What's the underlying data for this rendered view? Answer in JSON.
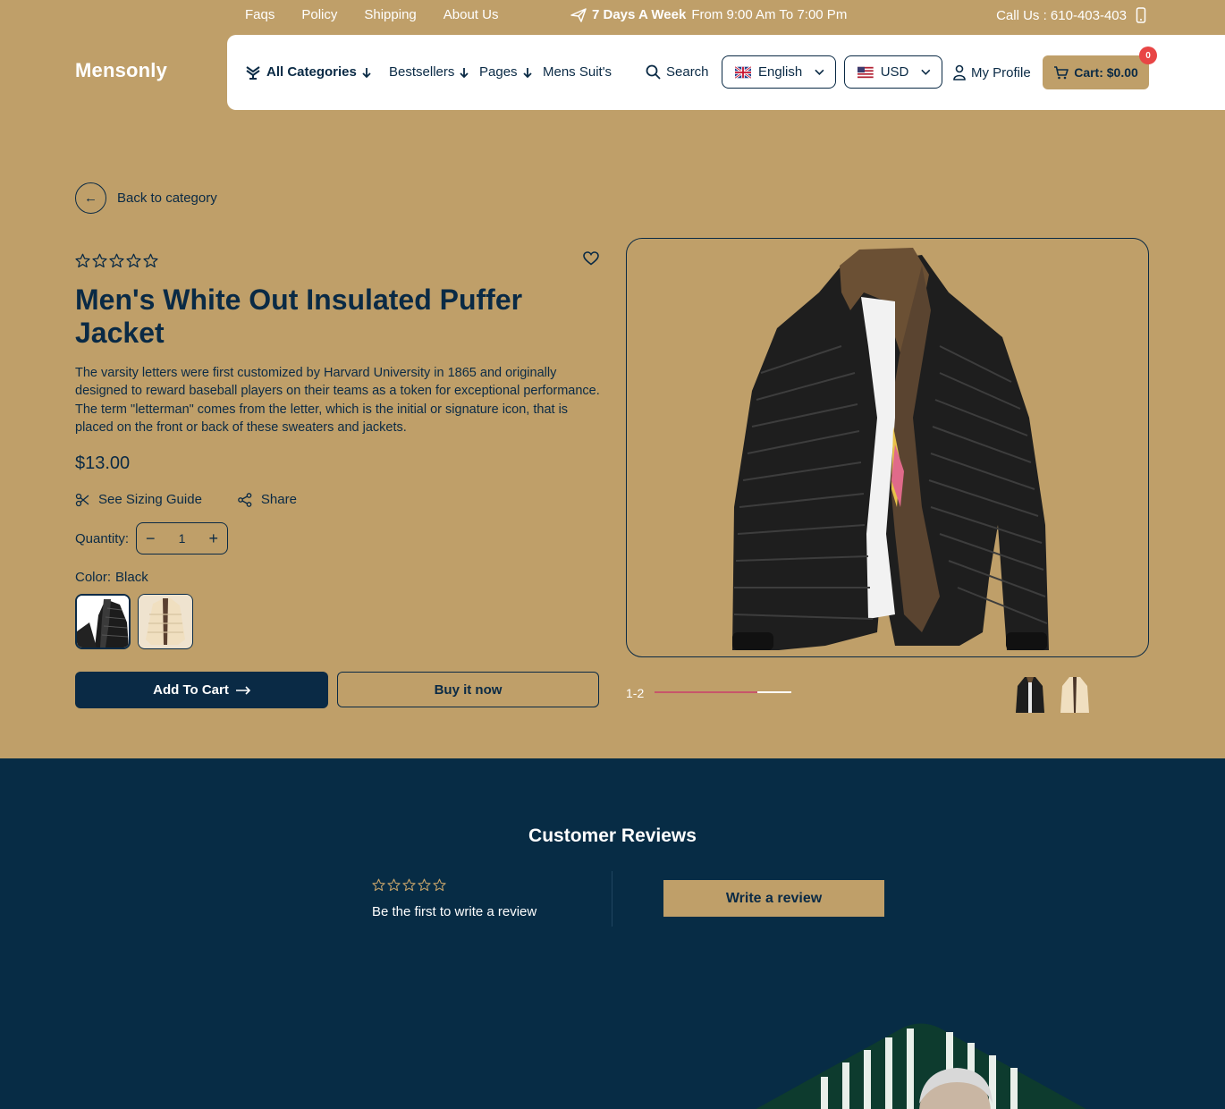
{
  "topbar": {
    "links": [
      "Faqs",
      "Policy",
      "Shipping",
      "About Us"
    ],
    "hours_bold": "7 Days A Week",
    "hours_rest": "From 9:00 Am To 7:00 Pm",
    "call": "Call Us : 610-403-403"
  },
  "header": {
    "logo": "Mensonly",
    "nav": {
      "all_categories": "All Categories",
      "bestsellers": "Bestsellers",
      "pages": "Pages",
      "mens_suits": "Mens Suit's"
    },
    "search": "Search",
    "language": "English",
    "currency": "USD",
    "profile": "My Profile",
    "cart": "Cart: $0.00",
    "cart_count": "0"
  },
  "back_label": "Back to category",
  "product": {
    "rating": 0,
    "title": "Men's White Out Insulated Puffer Jacket",
    "description": "The varsity letters were first customized by Harvard University in 1865 and originally designed to reward baseball players on their teams as a token for exceptional performance. The term \"letterman\" comes from the letter, which is the initial or signature icon, that is placed on the front or back of these sweaters and jackets.",
    "price": "$13.00",
    "sizing_guide": "See Sizing Guide",
    "share": "Share",
    "quantity_label": "Quantity:",
    "quantity": "1",
    "color_label": "Color:",
    "color_value": "Black",
    "add_to_cart": "Add To Cart",
    "buy_now": "Buy it now"
  },
  "gallery": {
    "pager": "1-2",
    "progress": 0.5
  },
  "reviews": {
    "title": "Customer Reviews",
    "empty_text": "Be the first to write a review",
    "write_button": "Write a review"
  },
  "colors": {
    "background": "#bf9f69",
    "navy": "#0a2a45",
    "reviews_bg": "#072c45",
    "badge": "#e84545"
  }
}
